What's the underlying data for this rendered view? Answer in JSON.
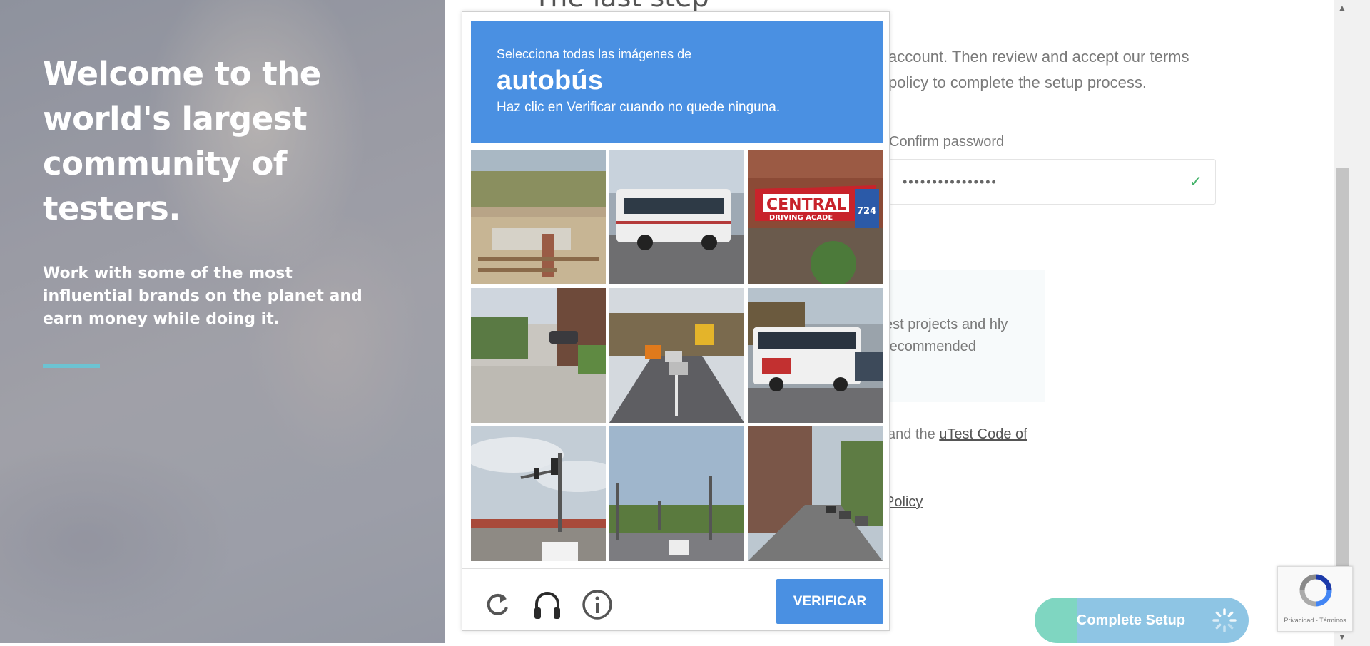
{
  "hero": {
    "title": "Welcome to the world's largest community of testers.",
    "subtitle": "Work with some of the most influential brands on the planet and earn money while doing it.",
    "accent_color": "#6cc3d2"
  },
  "form": {
    "step_title": "The last step",
    "intro": "account. Then review and accept our terms policy to complete the setup process.",
    "confirm_password_label": "Confirm password",
    "confirm_password_value": "••••••••••••••••",
    "info_text": "est projects and hly recommended",
    "terms_prefix": "and the ",
    "terms_link": "uTest Code of",
    "privacy_link": "Policy",
    "complete_button": "Complete Setup"
  },
  "captcha": {
    "line1": "Selecciona todas las imágenes de",
    "target": "autobús",
    "line3": "Haz clic en Verificar cuando no quede ninguna.",
    "verify_button": "VERIFICAR",
    "header_color": "#4a90e2",
    "controls": [
      "reload-icon",
      "headphones-icon",
      "info-icon"
    ],
    "tiles": [
      {
        "scene": "park-signpost"
      },
      {
        "scene": "bus"
      },
      {
        "scene": "driving-academy-storefront",
        "sign": "CENTRAL",
        "sign_sub": "DRIVING ACADE",
        "number": "724"
      },
      {
        "scene": "residential-street"
      },
      {
        "scene": "road-traffic-school-bus"
      },
      {
        "scene": "bus"
      },
      {
        "scene": "traffic-light"
      },
      {
        "scene": "intersection"
      },
      {
        "scene": "apartment-street"
      }
    ]
  },
  "recaptcha_badge": {
    "text": "Privacidad - Términos"
  }
}
